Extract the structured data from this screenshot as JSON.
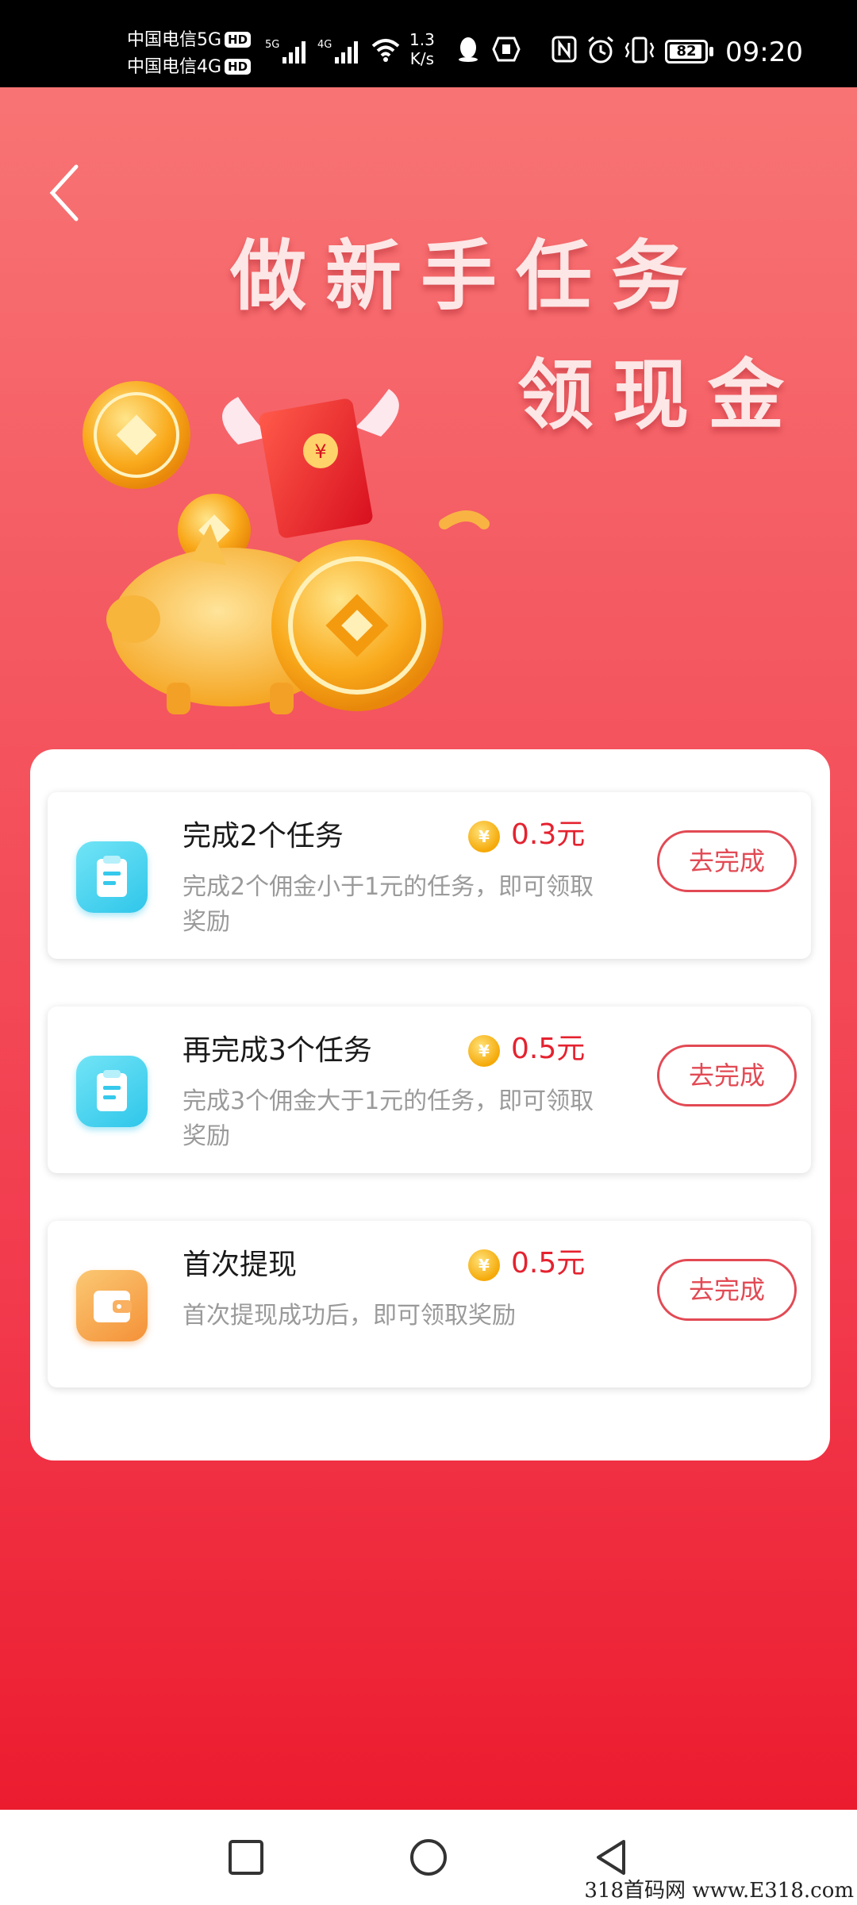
{
  "status_bar": {
    "carrier_1": "中国电信5G",
    "carrier_2": "中国电信4G",
    "hd_badge": "HD",
    "signal_1_label": "5G",
    "signal_2_label": "4G",
    "speed_value": "1.3",
    "speed_unit": "K/s",
    "battery": "82",
    "time": "09:20"
  },
  "hero": {
    "title_line1": "做新手任务",
    "title_line2": "领现金"
  },
  "tasks": [
    {
      "title": "完成2个任务",
      "reward": "0.3元",
      "description": "完成2个佣金小于1元的任务，即可领取奖励",
      "button": "去完成",
      "icon": "clipboard-icon"
    },
    {
      "title": "再完成3个任务",
      "reward": "0.5元",
      "description": "完成3个佣金大于1元的任务，即可领取奖励",
      "button": "去完成",
      "icon": "clipboard-icon"
    },
    {
      "title": "首次提现",
      "reward": "0.5元",
      "description": "首次提现成功后，即可领取奖励",
      "button": "去完成",
      "icon": "wallet-icon"
    }
  ],
  "coin_symbol": "¥",
  "nav": {
    "recent": "square-icon",
    "home": "circle-icon",
    "back": "triangle-back-icon"
  },
  "watermark": "318首码网 www.E318.com",
  "colors": {
    "accent": "#e5222f",
    "button_border": "#e24a54",
    "bg_top": "#f87474",
    "bg_bottom": "#ec1c2f"
  }
}
